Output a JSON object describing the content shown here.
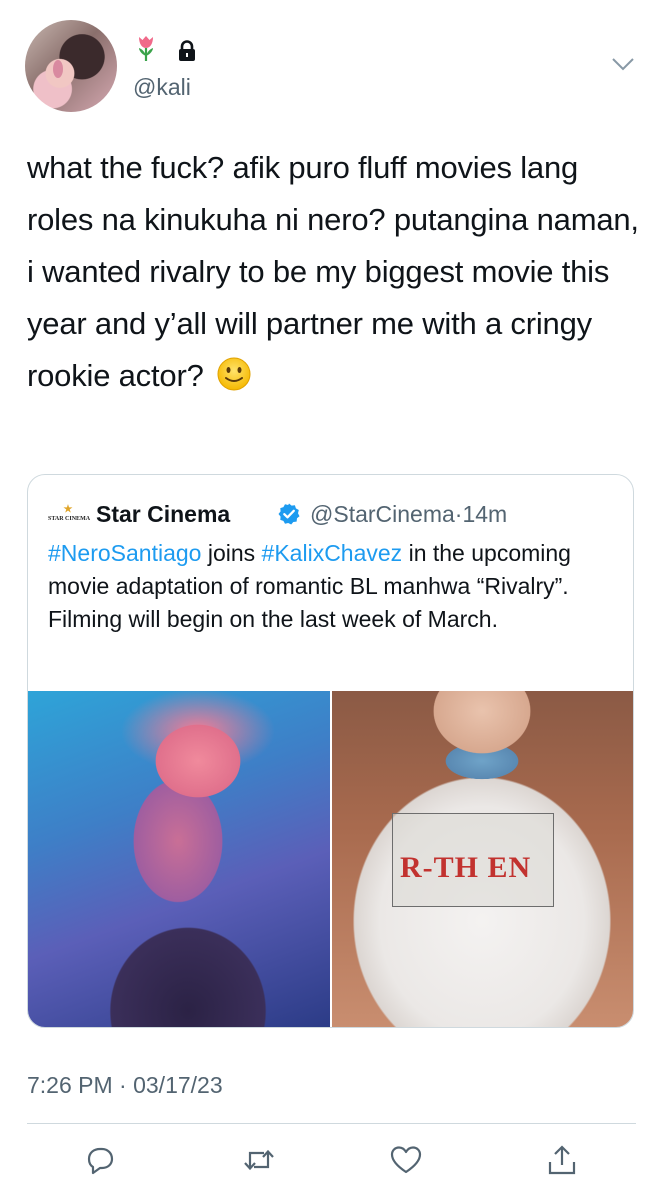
{
  "author": {
    "handle": "@kali",
    "avatar_icon": "avatar-photo",
    "badges": [
      "tulip-icon",
      "lock-icon"
    ]
  },
  "tweet": {
    "text": "what the fuck? afik puro fluff movies lang roles na kinukuha ni nero? putangina naman, i wanted rivalry to be my biggest movie this year and y’all will partner me with a cringy rookie actor?",
    "emoji": "slightly-smiling-face-icon"
  },
  "quote": {
    "logo_text": "STAR CINEMA",
    "name": "Star Cinema",
    "handle": "@StarCinema",
    "separator": "·",
    "time": "14m",
    "hashtag1": "#NeroSantiago",
    "text_part1": " joins ",
    "hashtag2": "#KalixChavez",
    "text_part2": " in the upcoming movie adaptation of romantic BL manhwa “Rivalry”. Filming will begin on the last week of March.",
    "photo_right_print": "R-TH EN"
  },
  "timestamp": "7:26 PM · 03/17/23",
  "colors": {
    "text": "#0f1419",
    "secondary": "#536471",
    "link": "#1d9bf0",
    "border": "#cfd9de"
  },
  "actions": [
    "reply-icon",
    "retweet-icon",
    "like-icon",
    "share-icon"
  ]
}
